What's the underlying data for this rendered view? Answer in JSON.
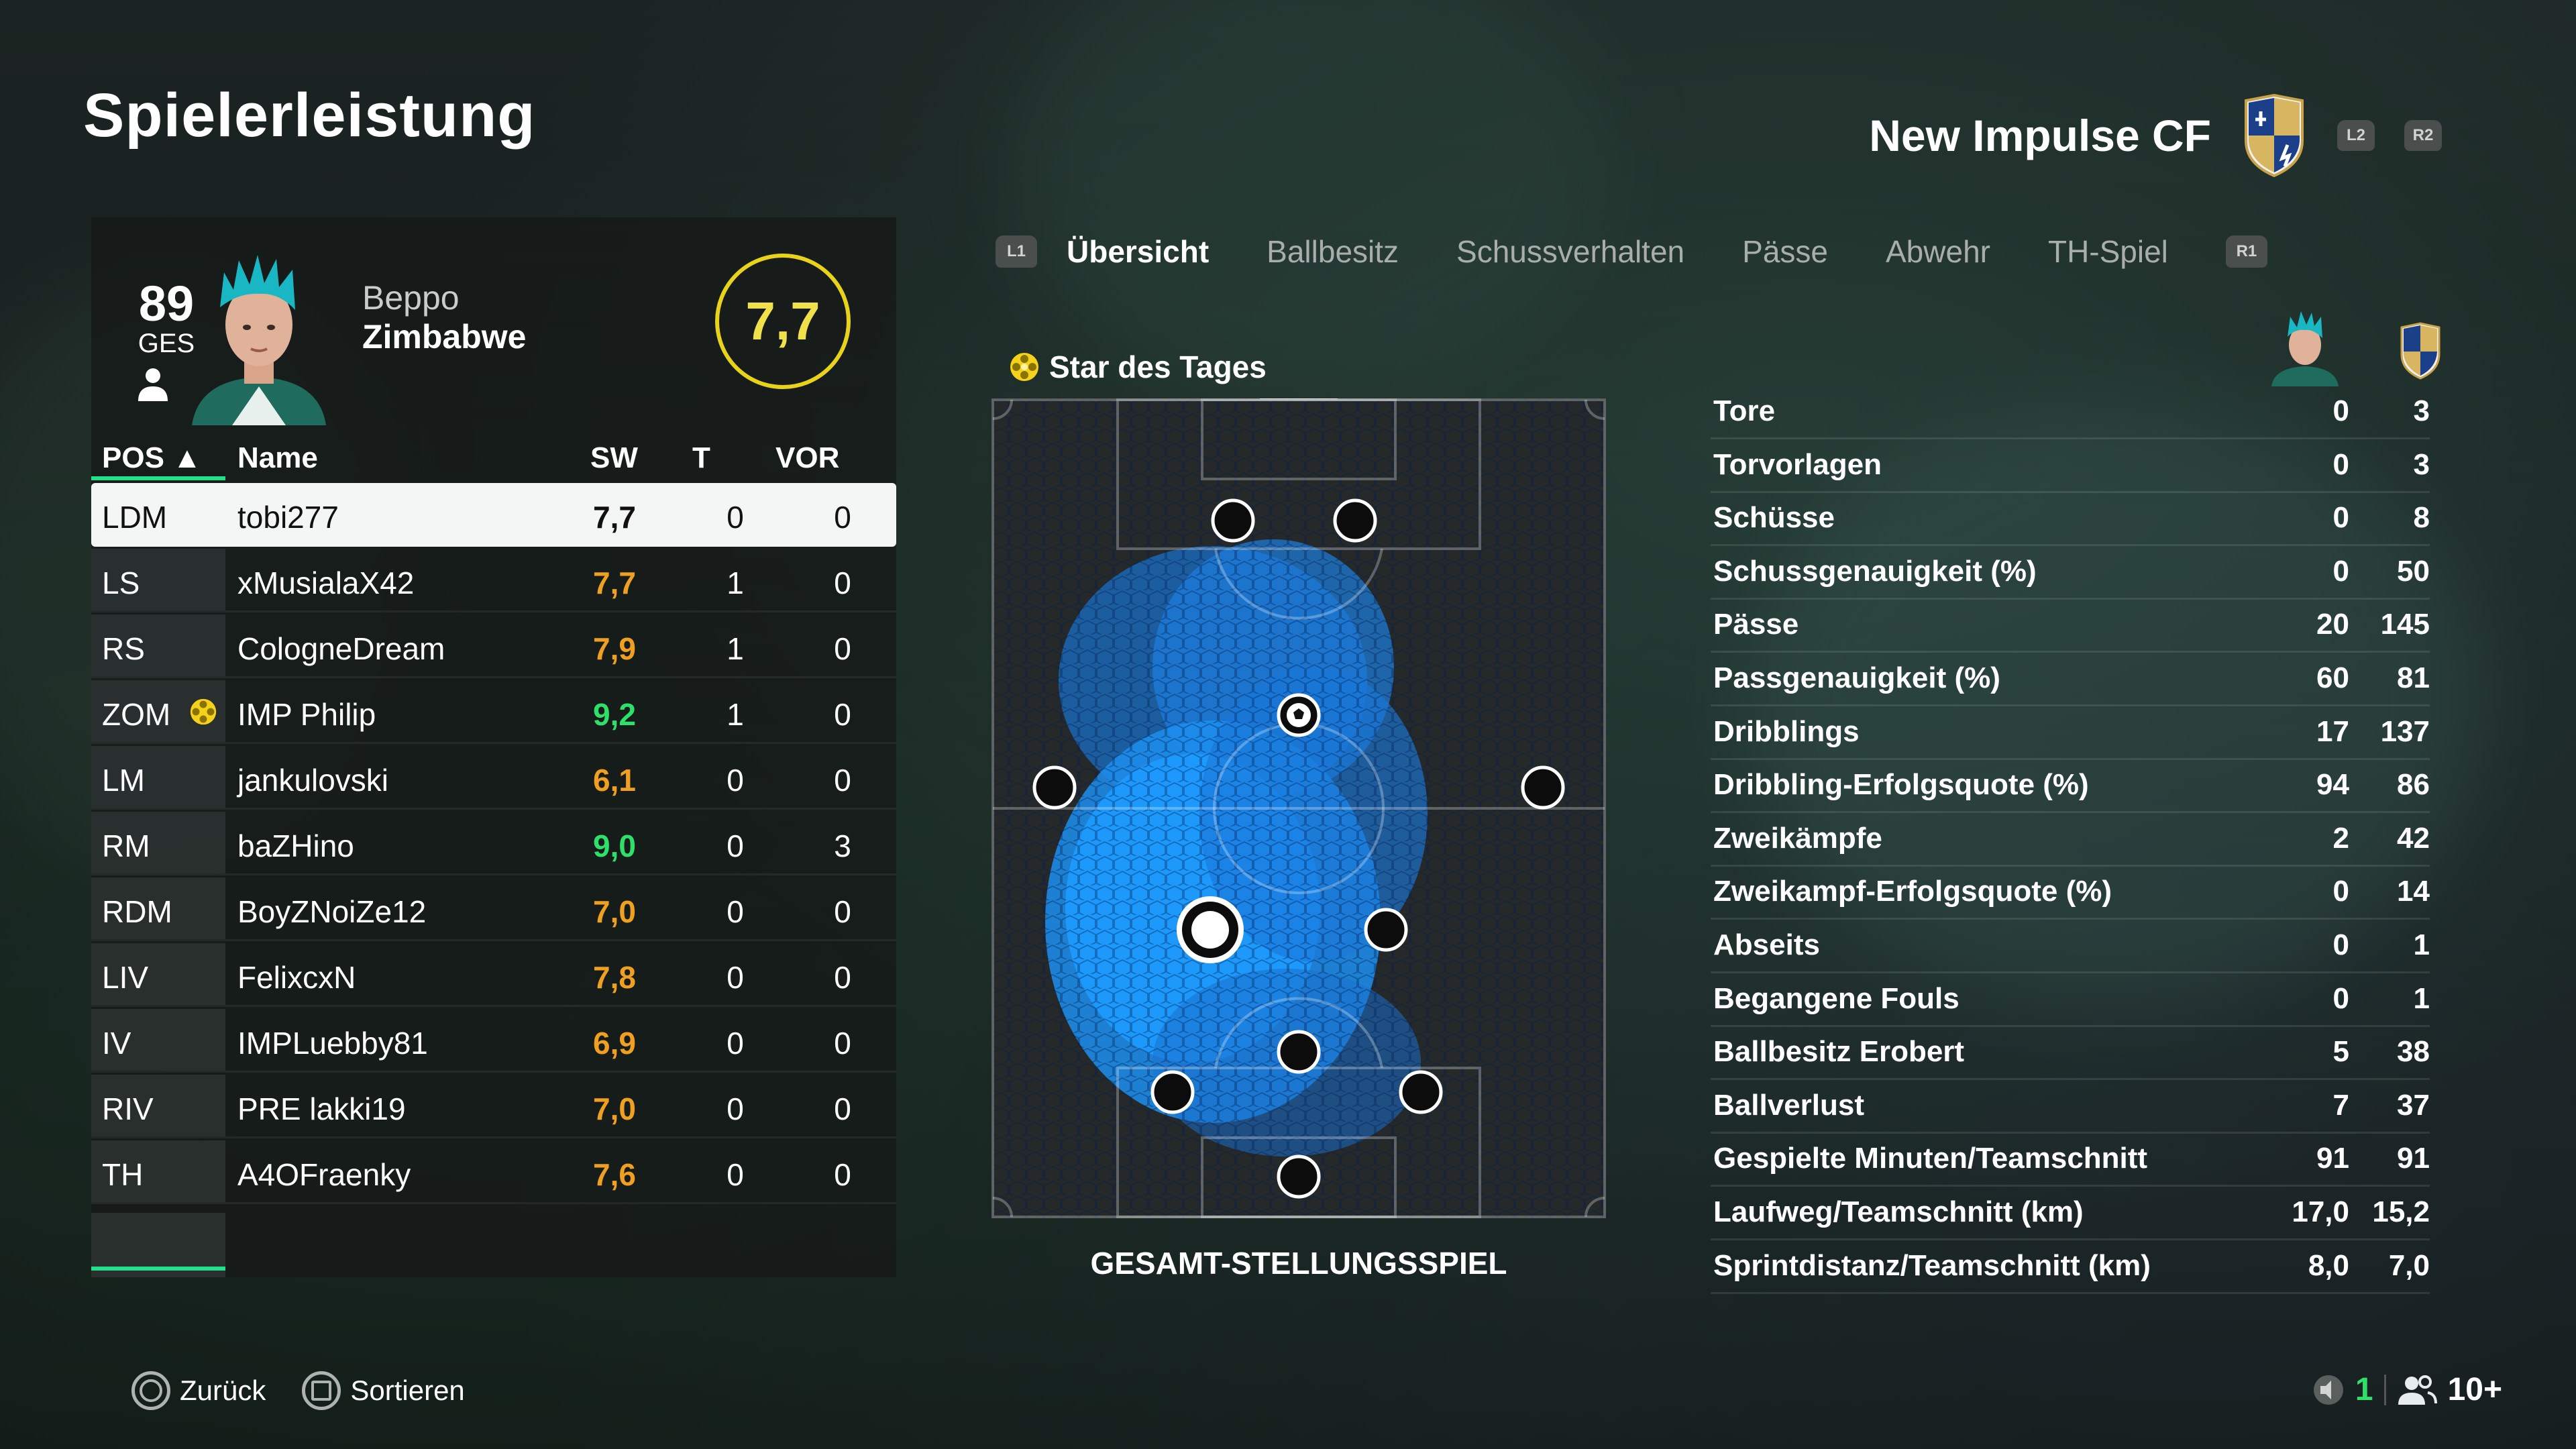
{
  "header": {
    "title": "Spielerleistung",
    "team_name": "New Impulse CF",
    "l2": "L2",
    "r2": "R2"
  },
  "player": {
    "ovr": "89",
    "ovr_label": "GES",
    "first_name": "Beppo",
    "last_name": "Zimbabwe",
    "rating": "7,7"
  },
  "table": {
    "headers": {
      "pos": "POS ▲",
      "name": "Name",
      "sw": "SW",
      "t": "T",
      "vor": "VOR"
    },
    "rows": [
      {
        "pos": "LDM",
        "name": "tobi277",
        "sw": "7,7",
        "t": "0",
        "vor": "0"
      },
      {
        "pos": "LS",
        "name": "xMusialaX42",
        "sw": "7,7",
        "t": "1",
        "vor": "0"
      },
      {
        "pos": "RS",
        "name": "CologneDream",
        "sw": "7,9",
        "t": "1",
        "vor": "0"
      },
      {
        "pos": "ZOM",
        "name": "IMP Philip",
        "sw": "9,2",
        "t": "1",
        "vor": "0"
      },
      {
        "pos": "LM",
        "name": "jankulovski",
        "sw": "6,1",
        "t": "0",
        "vor": "0"
      },
      {
        "pos": "RM",
        "name": "baZHino",
        "sw": "9,0",
        "t": "0",
        "vor": "3"
      },
      {
        "pos": "RDM",
        "name": "BoyZNoiZe12",
        "sw": "7,0",
        "t": "0",
        "vor": "0"
      },
      {
        "pos": "LIV",
        "name": "FelixcxN",
        "sw": "7,8",
        "t": "0",
        "vor": "0"
      },
      {
        "pos": "IV",
        "name": "IMPLuebby81",
        "sw": "6,9",
        "t": "0",
        "vor": "0"
      },
      {
        "pos": "RIV",
        "name": "PRE lakki19",
        "sw": "7,0",
        "t": "0",
        "vor": "0"
      },
      {
        "pos": "TH",
        "name": "A4OFraenky",
        "sw": "7,6",
        "t": "0",
        "vor": "0"
      }
    ]
  },
  "tabs": {
    "l1": "L1",
    "r1": "R1",
    "items": [
      "Übersicht",
      "Ballbesitz",
      "Schussverhalten",
      "Pässe",
      "Abwehr",
      "TH-Spiel"
    ]
  },
  "pitch": {
    "star_label": "Star des Tages",
    "caption": "GESAMT-STELLUNGSSPIEL"
  },
  "stats": [
    {
      "label": "Tore",
      "player": "0",
      "team": "3"
    },
    {
      "label": "Torvorlagen",
      "player": "0",
      "team": "3"
    },
    {
      "label": "Schüsse",
      "player": "0",
      "team": "8"
    },
    {
      "label": "Schussgenauigkeit (%)",
      "player": "0",
      "team": "50"
    },
    {
      "label": "Pässe",
      "player": "20",
      "team": "145"
    },
    {
      "label": "Passgenauigkeit (%)",
      "player": "60",
      "team": "81"
    },
    {
      "label": "Dribblings",
      "player": "17",
      "team": "137"
    },
    {
      "label": "Dribbling-Erfolgsquote (%)",
      "player": "94",
      "team": "86"
    },
    {
      "label": "Zweikämpfe",
      "player": "2",
      "team": "42"
    },
    {
      "label": "Zweikampf-Erfolgsquote (%)",
      "player": "0",
      "team": "14"
    },
    {
      "label": "Abseits",
      "player": "0",
      "team": "1"
    },
    {
      "label": "Begangene Fouls",
      "player": "0",
      "team": "1"
    },
    {
      "label": "Ballbesitz Erobert",
      "player": "5",
      "team": "38"
    },
    {
      "label": "Ballverlust",
      "player": "7",
      "team": "37"
    },
    {
      "label": "Gespielte Minuten/Teamschnitt",
      "player": "91",
      "team": "91"
    },
    {
      "label": "Laufweg/Teamschnitt (km)",
      "player": "17,0",
      "team": "15,2"
    },
    {
      "label": "Sprintdistanz/Teamschnitt (km)",
      "player": "8,0",
      "team": "7,0"
    }
  ],
  "footer": {
    "back": "Zurück",
    "sort": "Sortieren",
    "mic_count": "1",
    "players_count": "10+"
  },
  "colors": {
    "accent_green": "#22e08a",
    "rating_ring": "#e8d21a",
    "heat_blue": "#1e9bff",
    "sw_orange": "#f0a020",
    "sw_green": "#2ee06a"
  }
}
